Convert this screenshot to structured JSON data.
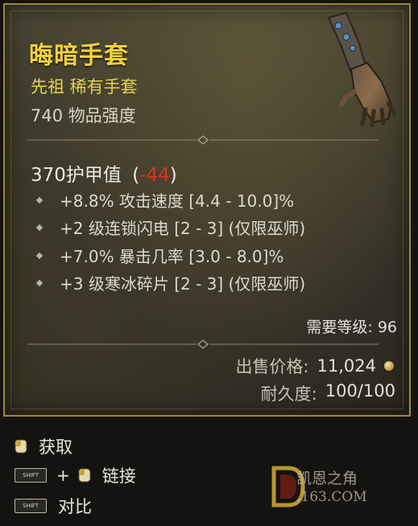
{
  "item": {
    "name": "晦暗手套",
    "type": "先祖 稀有手套",
    "power": "740 物品强度",
    "armor_value": "370护甲值",
    "armor_delta": "-44",
    "armor_open": "(",
    "armor_close": ")",
    "affixes": [
      "+8.8% 攻击速度 [4.4 - 10.0]%",
      "+2 级连锁闪电 [2 - 3] (仅限巫师)",
      "+7.0% 暴击几率 [3.0 - 8.0]%",
      "+3 级寒冰碎片 [2 - 3] (仅限巫师)"
    ],
    "required_level": "需要等级: 96",
    "sell_label": "出售价格:",
    "sell_value": "11,024",
    "durability_label": "耐久度:",
    "durability_value": "100/100",
    "icon": "gauntlet-icon"
  },
  "actions": {
    "acquire": "获取",
    "link": "链接",
    "compare": "对比",
    "shift_key": "SHIFT",
    "plus": "+"
  },
  "watermark": {
    "line1": "凯恩之角",
    "line2": ".163.COM"
  },
  "colors": {
    "rare_name": "#f2d23a",
    "rare_type": "#e3d054",
    "negative": "#e0302a",
    "border": "#9a8a3a"
  }
}
